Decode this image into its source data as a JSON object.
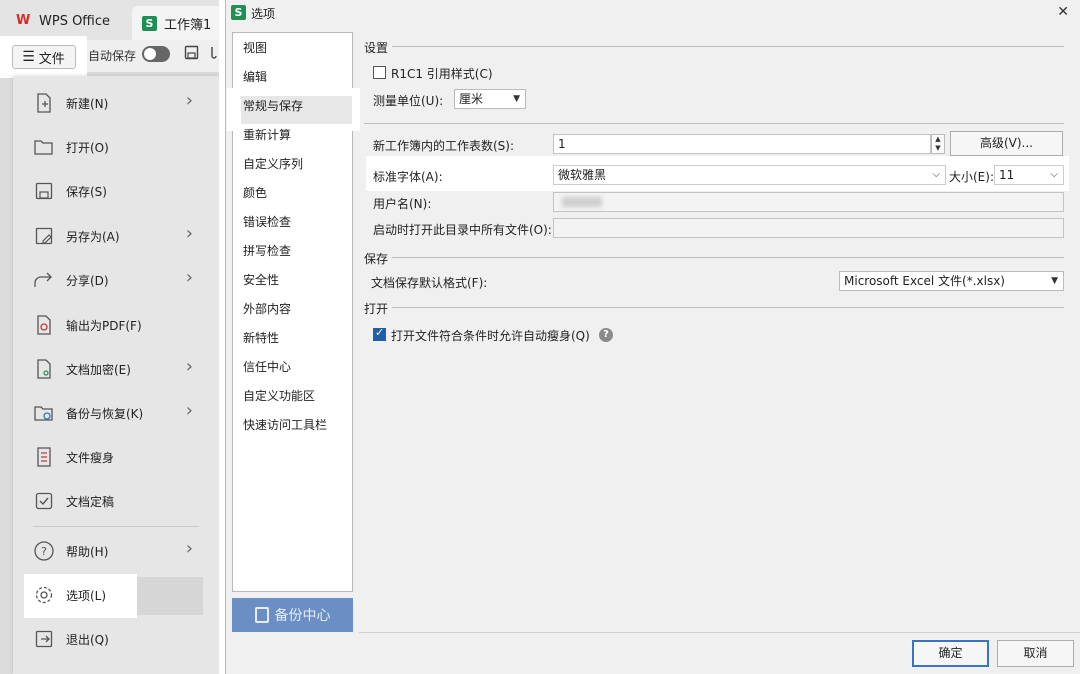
{
  "wps": {
    "app_name": "WPS Office",
    "doc_tab": "工作簿1",
    "file_button": "文件",
    "autosave_label": "自动保存",
    "menu": [
      {
        "label": "新建(N)",
        "icon": "new-file-icon",
        "arrow": true
      },
      {
        "label": "打开(O)",
        "icon": "folder-open-icon",
        "arrow": false
      },
      {
        "label": "保存(S)",
        "icon": "save-icon",
        "arrow": false
      },
      {
        "label": "另存为(A)",
        "icon": "save-as-icon",
        "arrow": true
      },
      {
        "label": "分享(D)",
        "icon": "share-icon",
        "arrow": true
      },
      {
        "label": "输出为PDF(F)",
        "icon": "pdf-icon",
        "arrow": false
      },
      {
        "label": "文档加密(E)",
        "icon": "encrypt-icon",
        "arrow": true
      },
      {
        "label": "备份与恢复(K)",
        "icon": "backup-icon",
        "arrow": true
      },
      {
        "label": "文件瘦身",
        "icon": "slim-file-icon",
        "arrow": false
      },
      {
        "label": "文档定稿",
        "icon": "finalize-icon",
        "arrow": false
      },
      {
        "label": "帮助(H)",
        "icon": "help-icon",
        "arrow": true
      },
      {
        "label": "选项(L)",
        "icon": "gear-icon",
        "arrow": false
      },
      {
        "label": "退出(Q)",
        "icon": "exit-icon",
        "arrow": false
      }
    ]
  },
  "dialog": {
    "title": "选项",
    "categories": [
      "视图",
      "编辑",
      "常规与保存",
      "重新计算",
      "自定义序列",
      "颜色",
      "错误检查",
      "拼写检查",
      "安全性",
      "外部内容",
      "新特性",
      "信任中心",
      "自定义功能区",
      "快速访问工具栏"
    ],
    "backup_center": "备份中心",
    "settings": {
      "section": "设置",
      "r1c1_label": "R1C1 引用样式(C)",
      "unit_label": "测量单位(U):",
      "unit_value": "厘米",
      "sheets_label": "新工作簿内的工作表数(S):",
      "sheets_value": "1",
      "advanced_button": "高级(V)...",
      "font_label": "标准字体(A):",
      "font_value": "微软雅黑",
      "size_label": "大小(E):",
      "size_value": "11",
      "username_label": "用户名(N):",
      "startup_label": "启动时打开此目录中所有文件(O):"
    },
    "save": {
      "section": "保存",
      "format_label": "文档保存默认格式(F):",
      "format_value": "Microsoft Excel 文件(*.xlsx)"
    },
    "open": {
      "section": "打开",
      "slim_label": "打开文件符合条件时允许自动瘦身(Q)",
      "slim_checked": true
    },
    "ok_button": "确定",
    "cancel_button": "取消"
  }
}
